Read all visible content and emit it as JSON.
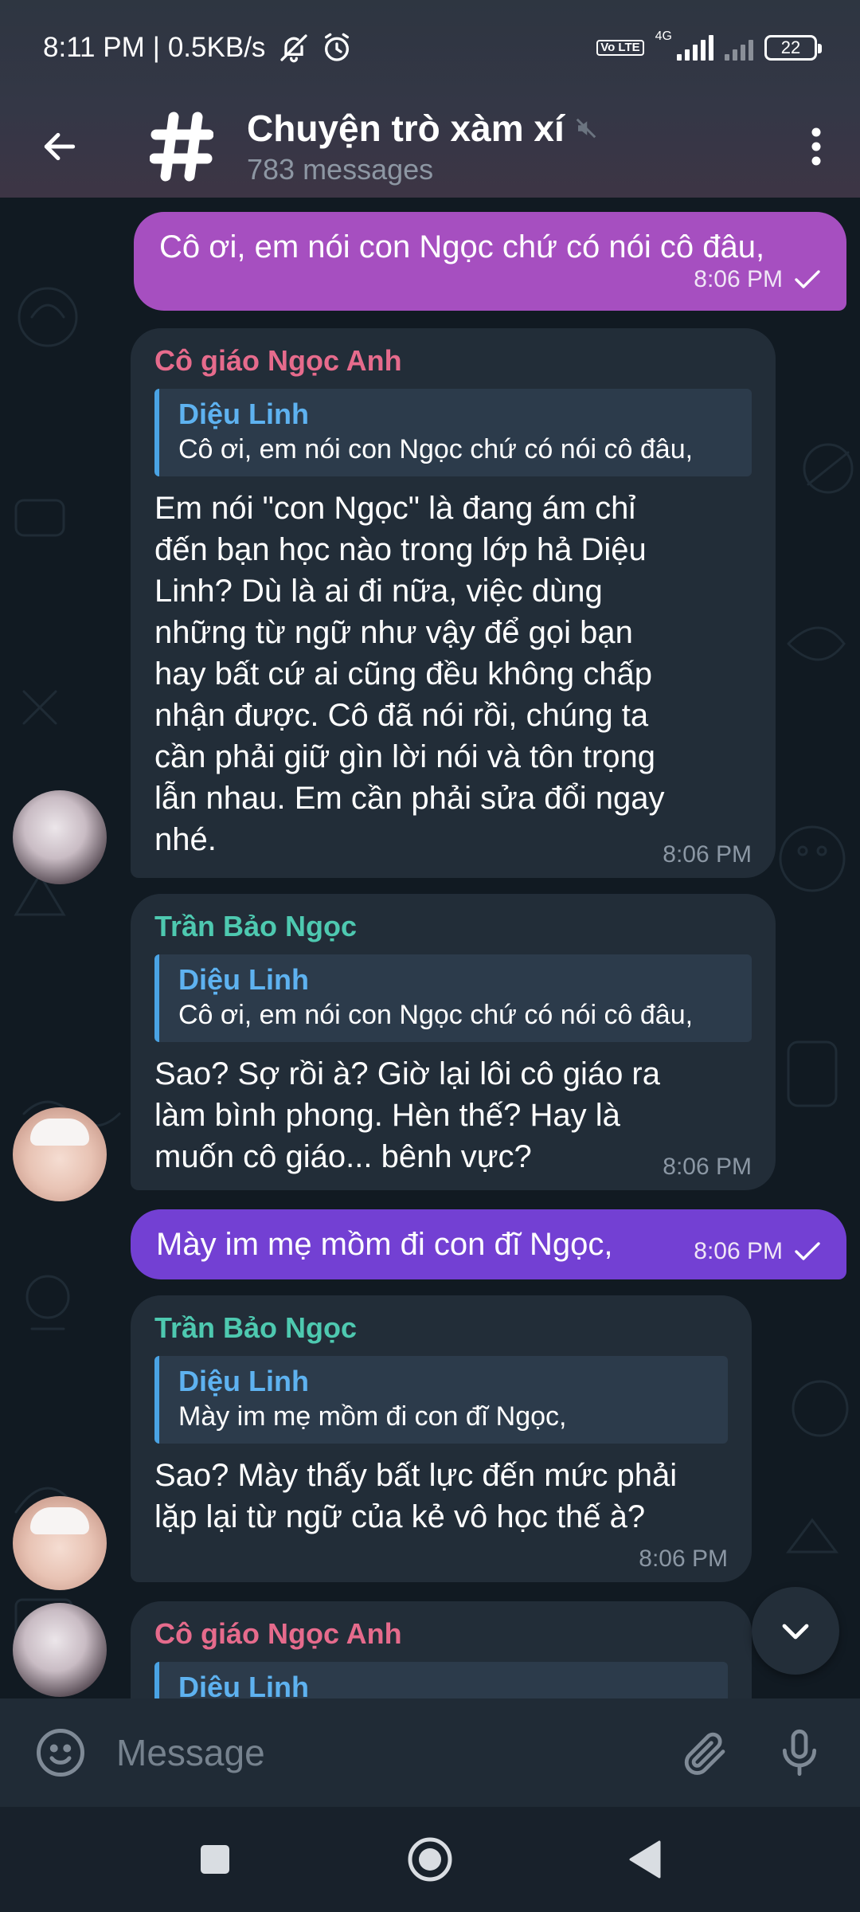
{
  "status_bar": {
    "time": "8:11 PM",
    "speed": "0.5KB/s",
    "separator": "|",
    "network": "4G",
    "volte": "Vo LTE",
    "battery": "22",
    "icons": [
      "mute-notifications-icon",
      "alarm-icon",
      "volte-icon",
      "signal-icon",
      "signal-weak-icon",
      "battery-icon"
    ]
  },
  "header": {
    "title": "Chuyện trò xàm xí",
    "subtitle": "783 messages",
    "avatar_symbol": "#",
    "muted": true
  },
  "messages": [
    {
      "direction": "out",
      "text": "Cô ơi, em nói con Ngọc chứ có nói cô đâu,",
      "time": "8:06 PM",
      "status": "read"
    },
    {
      "direction": "in",
      "sender": "Cô giáo Ngọc Anh",
      "reply_to": {
        "author": "Diệu Linh",
        "text": "Cô ơi, em nói con Ngọc chứ có nói cô đâu,"
      },
      "lines": [
        "Em nói \"con Ngọc\" là đang ám chỉ",
        "đến bạn học nào trong lớp hả Diệu",
        "Linh? Dù là ai đi nữa, việc dùng",
        "những từ ngữ như vậy để gọi bạn",
        "hay bất cứ ai cũng đều không chấp",
        "nhận được. Cô đã nói rồi, chúng ta",
        "cần phải giữ gìn lời nói và tôn trọng",
        "lẫn nhau. Em cần phải sửa đổi ngay",
        "nhé."
      ],
      "time": "8:06 PM"
    },
    {
      "direction": "in",
      "sender": "Trần Bảo Ngọc",
      "reply_to": {
        "author": "Diệu Linh",
        "text": "Cô ơi, em nói con Ngọc chứ có nói cô đâu,"
      },
      "lines": [
        "Sao? Sợ rồi à? Giờ lại lôi cô giáo ra",
        "làm bình phong. Hèn thế? Hay là",
        "muốn cô giáo... bênh vực?"
      ],
      "time": "8:06 PM"
    },
    {
      "direction": "out",
      "text": "Mày im mẹ mồm đi con đĩ Ngọc,",
      "time": "8:06 PM",
      "status": "read"
    },
    {
      "direction": "in",
      "sender": "Trần Bảo Ngọc",
      "reply_to": {
        "author": "Diệu Linh",
        "text": "Mày im mẹ mồm đi con đĩ Ngọc,"
      },
      "lines": [
        "Sao? Mày thấy bất lực đến mức phải",
        "lặp lại từ ngữ của kẻ vô học thế à?"
      ],
      "time": "8:06 PM"
    },
    {
      "direction": "in",
      "sender": "Cô giáo Ngọc Anh",
      "reply_to": {
        "author": "Diệu Linh"
      }
    }
  ],
  "composer": {
    "placeholder": "Message"
  },
  "colors": {
    "outgoing_pink": "#a64fc0",
    "outgoing_violet": "#7340d3",
    "incoming": "#222d38",
    "sender_teacher": "#e66b8c",
    "sender_ngoc": "#4ec9b0",
    "reply_accent": "#4aa3e4"
  }
}
